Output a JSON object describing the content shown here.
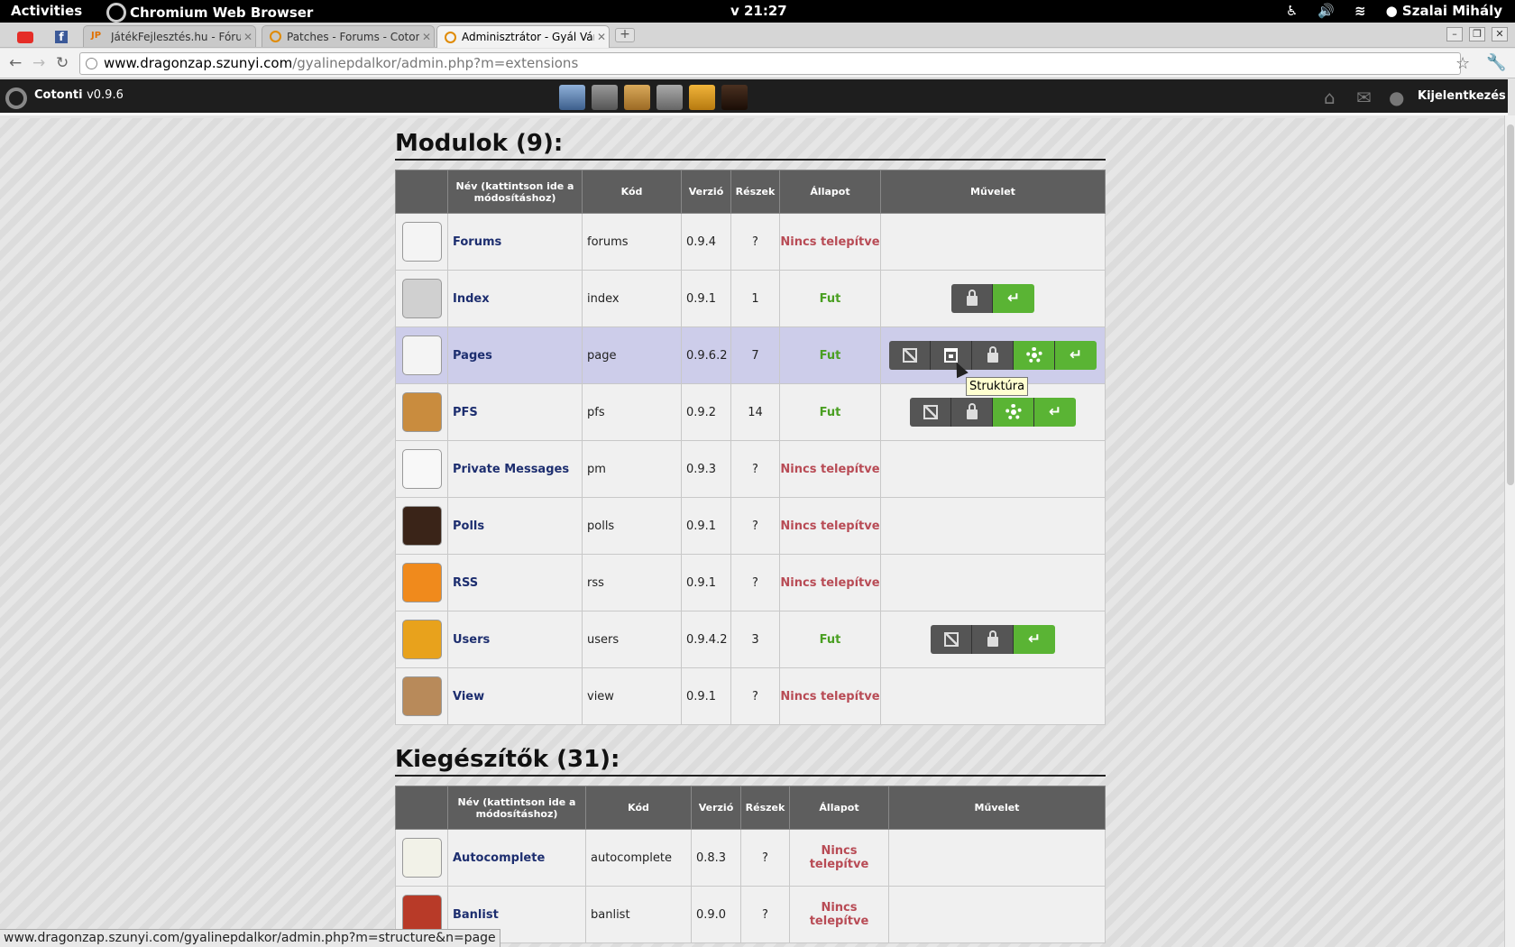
{
  "system": {
    "activities": "Activities",
    "app_name": "Chromium Web Browser",
    "clock": "v 21:27",
    "user": "Szalai Mihály"
  },
  "browser": {
    "tabs": [
      {
        "label": "JátékFejlesztés.hu - Fórum",
        "active": false
      },
      {
        "label": "Patches - Forums - Cotonti",
        "active": false
      },
      {
        "label": "Adminisztrátor - Gyál Város",
        "active": true
      }
    ],
    "address": {
      "host": "www.dragonzap.szunyi.com",
      "path": "/gyalinepdalkor/admin.php?m=extensions"
    },
    "status_url": "www.dragonzap.szunyi.com/gyalinepdalkor/admin.php?m=structure&n=page"
  },
  "admin_header": {
    "brand": "Cotonti",
    "version": "v0.9.6",
    "logout": "Kijelentkezés"
  },
  "tooltip": "Struktúra",
  "columns": {
    "name": "Név (kattintson ide a módosításhoz)",
    "code": "Kód",
    "version": "Verzió",
    "parts": "Részek",
    "state": "Állapot",
    "action": "Művelet"
  },
  "modules": {
    "title": "Modulok (9):",
    "rows": [
      {
        "name": "Forums",
        "code": "forums",
        "version": "0.9.4",
        "parts": "?",
        "state": "Nincs telepítve",
        "installed": false,
        "icon": "forums-icon",
        "color": "#f4f4f4",
        "buttons": []
      },
      {
        "name": "Index",
        "code": "index",
        "version": "0.9.1",
        "parts": "1",
        "state": "Fut",
        "installed": true,
        "icon": "home-icon",
        "color": "#d0d0d0",
        "buttons": [
          "lock",
          "enter"
        ]
      },
      {
        "name": "Pages",
        "code": "page",
        "version": "0.9.6.2",
        "parts": "7",
        "state": "Fut",
        "installed": true,
        "icon": "pages-icon",
        "color": "#f4f4f4",
        "buttons": [
          "edit",
          "structure",
          "lock",
          "config",
          "enter"
        ],
        "highlight": true
      },
      {
        "name": "PFS",
        "code": "pfs",
        "version": "0.9.2",
        "parts": "14",
        "state": "Fut",
        "installed": true,
        "icon": "pfs-icon",
        "color": "#c98c3e",
        "buttons": [
          "edit",
          "lock",
          "config",
          "enter"
        ]
      },
      {
        "name": "Private Messages",
        "code": "pm",
        "version": "0.9.3",
        "parts": "?",
        "state": "Nincs telepítve",
        "installed": false,
        "icon": "envelope-icon",
        "color": "#f8f8f8",
        "buttons": []
      },
      {
        "name": "Polls",
        "code": "polls",
        "version": "0.9.1",
        "parts": "?",
        "state": "Nincs telepítve",
        "installed": false,
        "icon": "pulse-icon",
        "color": "#3a2418",
        "buttons": []
      },
      {
        "name": "RSS",
        "code": "rss",
        "version": "0.9.1",
        "parts": "?",
        "state": "Nincs telepítve",
        "installed": false,
        "icon": "rss-icon",
        "color": "#f08a1c",
        "buttons": []
      },
      {
        "name": "Users",
        "code": "users",
        "version": "0.9.4.2",
        "parts": "3",
        "state": "Fut",
        "installed": true,
        "icon": "users-icon",
        "color": "#e8a21c",
        "buttons": [
          "edit",
          "lock",
          "enter"
        ]
      },
      {
        "name": "View",
        "code": "view",
        "version": "0.9.1",
        "parts": "?",
        "state": "Nincs telepítve",
        "installed": false,
        "icon": "magnifier-icon",
        "color": "#b88a5a",
        "buttons": []
      }
    ]
  },
  "plugins": {
    "title": "Kiegészítők (31):",
    "rows": [
      {
        "name": "Autocomplete",
        "code": "autocomplete",
        "version": "0.8.3",
        "parts": "?",
        "state": "Nincs telepítve",
        "installed": false,
        "icon": "notepad-icon",
        "color": "#f2f2e8",
        "buttons": []
      },
      {
        "name": "Banlist",
        "code": "banlist",
        "version": "0.9.0",
        "parts": "?",
        "state": "Nincs telepítve",
        "installed": false,
        "icon": "brick-wall-icon",
        "color": "#b83a28",
        "buttons": []
      }
    ]
  }
}
